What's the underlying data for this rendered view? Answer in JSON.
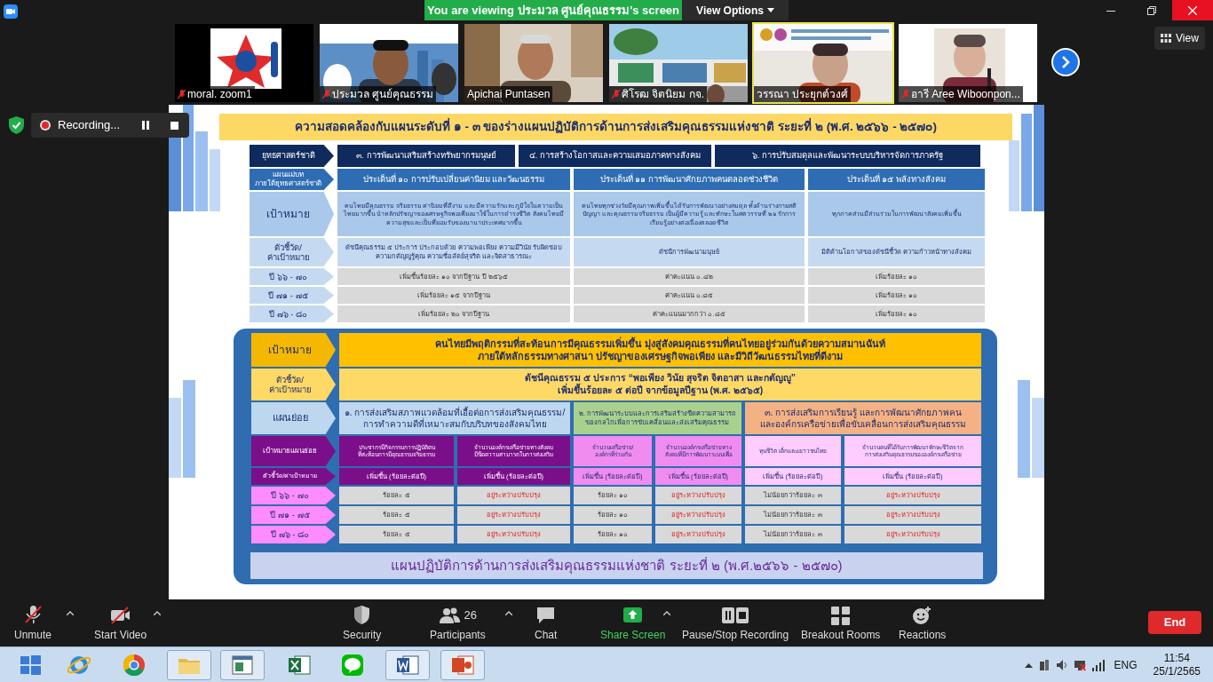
{
  "window": {
    "banner": "You are viewing ประมวล ศูนย์คุณธรรม's screen",
    "view_options": "View Options",
    "view_button": "View"
  },
  "participants": [
    {
      "name": "moral. zoom1",
      "muted": true,
      "selected": false
    },
    {
      "name": "ประมวล ศูนย์คุณธรรม",
      "muted": true,
      "selected": false
    },
    {
      "name": "Apichai Puntasen",
      "muted": false,
      "selected": false
    },
    {
      "name": "ศิโรฒ จิตนิยม  กจ.",
      "muted": true,
      "selected": false
    },
    {
      "name": "วรรณา ประยุกต์วงศ์",
      "muted": false,
      "selected": true
    },
    {
      "name": "อารี Aree Wiboonpon...",
      "muted": true,
      "selected": false
    }
  ],
  "recording": {
    "label": "Recording..."
  },
  "slide": {
    "title": "ความสอดคล้องกับแผนระดับที่ ๑ - ๓ ของร่างแผนปฏิบัติการด้านการส่งเสริมคุณธรรมแห่งชาติ ระยะที่ ๒ (พ.ศ. ๒๕๖๖ - ๒๕๗๐)",
    "alignment_table": [
      {
        "kind": "strategy",
        "label": "ยุทธศาสตร์ชาติ",
        "cells": [
          {
            "text": "๓. การพัฒนาเสริมสร้างทรัพยากรมนุษย์"
          },
          {
            "text": "๔. การสร้างโอกาสและความเสมอภาคทางสังคม"
          },
          {
            "text": "๖. การปรับสมดุลและพัฒนาระบบบริหารจัดการภาครัฐ"
          }
        ]
      },
      {
        "kind": "plan",
        "label": "แผนแม่บท\nภายใต้ยุทธศาสตร์ชาติ",
        "cells": [
          {
            "text": "ประเด็นที่ ๑๐ การปรับเปลี่ยนค่านิยม และวัฒนธรรม"
          },
          {
            "text": "ประเด็นที่ ๑๑ การพัฒนาศักยภาพคนตลอดช่วงชีวิต"
          },
          {
            "text": "ประเด็นที่ ๑๕ พลังทางสังคม"
          }
        ]
      },
      {
        "kind": "goal",
        "label": "เป้าหมาย",
        "cells": [
          {
            "text": "คนไทยมีคุณธรรม จริยธรรม ค่านิยมที่ดีงาม และมีความรักและภูมิใจในความเป็นไทยมากขึ้น นำหลักปรัชญาของเศรษฐกิจพอเพียงมาใช้ในการดำรงชีวิต สังคมไทยมีความสุขและเป็นที่ยอมรับของนานาประเทศมากขึ้น"
          },
          {
            "text": "คนไทยทุกช่วงวัยมีคุณภาพเพิ่มขึ้นได้รับการพัฒนาอย่างสมดุล ทั้งด้านร่างกายสติปัญญา และคุณธรรมจริยธรรม เป็นผู้มีความรู้ และทักษะในศตวรรษที่ ๒๑ รักการเรียนรู้อย่างต่อเนื่องตลอดชีวิต"
          },
          {
            "text": "ทุกภาคส่วนมีส่วนร่วมในการพัฒนาสังคมเพิ่มขึ้น"
          }
        ]
      },
      {
        "kind": "indicator",
        "label": "ตัวชี้วัด/\nค่าเป้าหมาย",
        "cells": [
          {
            "text": "ดัชนีคุณธรรม ๕ ประการ ประกอบด้วย ความพอเพียง ความมีวินัย รับผิดชอบ ความกตัญญูรู้คุณ ความซื่อสัตย์สุจริต และจิตสาธารณะ"
          },
          {
            "text": "ดัชนีการพัฒนามนุษย์"
          },
          {
            "text": "มิติด้านโอกาสของดัชนีชี้วัด ความก้าวหน้าทางสังคม"
          }
        ]
      },
      {
        "kind": "year",
        "label": "ปี ๖๖ - ๗๐",
        "cells": [
          {
            "text": "เพิ่มขึ้นร้อยละ ๑๐ จากปีฐาน ปี ๒๕๖๕"
          },
          {
            "text": "ค่าคะแนน ๐.๘๒"
          },
          {
            "text": "เพิ่มร้อยละ ๑๐"
          }
        ]
      },
      {
        "kind": "year",
        "label": "ปี ๗๑ - ๗๕",
        "cells": [
          {
            "text": "เพิ่มร้อยละ ๑๕ จากปีฐาน"
          },
          {
            "text": "ค่าคะแนน ๐.๘๕"
          },
          {
            "text": "เพิ่มร้อยละ ๑๐"
          }
        ]
      },
      {
        "kind": "year",
        "label": "ปี ๗๖ - ๘๐",
        "cells": [
          {
            "text": "เพิ่มร้อยละ ๒๐ จากปีฐาน"
          },
          {
            "text": "ค่าคะแนนมากกว่า ๐.๘๕"
          },
          {
            "text": "เพิ่มร้อยละ ๑๐"
          }
        ]
      }
    ],
    "plan_table": [
      {
        "kind": "goal",
        "label": "เป้าหมาย",
        "cells": [
          {
            "text": "คนไทยมีพฤติกรรมที่สะท้อนการมีคุณธรรมเพิ่มขึ้น มุ่งสู่สังคมคุณธรรมที่คนไทยอยู่ร่วมกันด้วยความสมานฉันท์\nภายใต้หลักธรรมทางศาสนา ปรัชญาของเศรษฐกิจพอเพียง และมีวิถีวัฒนธรรมไทยที่ดีงาม"
          }
        ]
      },
      {
        "kind": "indicator",
        "label": "ตัวชี้วัด/\nค่าเป้าหมาย",
        "cells": [
          {
            "text": "ดัชนีคุณธรรม ๕ ประการ “พอเพียง วินัย สุจริต จิตอาสา และกตัญญู”\nเพิ่มขึ้นร้อยละ ๕ ต่อปี จากข้อมูลปีฐาน (พ.ศ. ๒๕๖๕)"
          }
        ]
      },
      {
        "kind": "subplan",
        "label": "แผนย่อย",
        "cells": [
          {
            "text": "๑. การส่งเสริมสภาพแวดล้อมที่เอื้อต่อการส่งเสริมคุณธรรม/\nการทำความดีที่เหมาะสมกับบริบทของสังคมไทย"
          },
          {
            "text": "๒. การพัฒนาระบบและการเสริมสร้างขีดความสามารถ\nของกลไกเพื่อการขับเคลื่อนและส่งเสริมคุณธรรม"
          },
          {
            "text": "๓. การส่งเสริมการเรียนรู้ และการพัฒนาศักยภาพคน\nและองค์กรเครือข่ายเพื่อขับเคลื่อนการส่งเสริมคุณธรรม"
          }
        ]
      },
      {
        "kind": "subgoal",
        "label": "เป้าหมายแผนย่อย",
        "cells": [
          {
            "text": "ประชากรมีกิจกรรมการปฏิบัติตน\nที่สะท้อนการมีคุณธรรมจริยธรรม"
          },
          {
            "text": "จำนวนองค์กรเครือข่ายทางสังคม\nมีขีดความสามารถในการส่งเสริม"
          },
          {
            "text": "จำนวนเครือข่าย/\nองค์กรที่ร่วมกัน"
          },
          {
            "text": "จำนวนองค์กรเครือข่ายทาง\nสังคมที่มีการพัฒนาระบบเพื่อ"
          },
          {
            "text": "ทุนชีวิต เด็กและเยาวชนไทย"
          },
          {
            "text": "จำนวนคนที่ได้รับการพัฒนาทักษะชีวิตจาก\nการส่งเสริมคุณธรรมขององค์กรเครือข่าย"
          }
        ]
      },
      {
        "kind": "metric",
        "label": "ตัวชี้วัด/ค่าเป้าหมาย",
        "cells": [
          {
            "text": "เพิ่มขึ้น (ร้อยละต่อปี)"
          },
          {
            "text": "เพิ่มขึ้น (ร้อยละต่อปี)"
          },
          {
            "text": "เพิ่มขึ้น (ร้อยละต่อปี)"
          },
          {
            "text": "เพิ่มขึ้น (ร้อยละต่อปี)"
          },
          {
            "text": "เพิ่มขึ้น (ร้อยละต่อปี)"
          },
          {
            "text": "เพิ่มขึ้น (ร้อยละต่อปี)"
          }
        ]
      },
      {
        "kind": "year",
        "label": "ปี ๖๖ - ๗๐",
        "cells": [
          {
            "text": "ร้อยละ ๕",
            "pending": false
          },
          {
            "text": "อยู่ระหว่างปรับปรุง",
            "pending": true
          },
          {
            "text": "ร้อยละ ๑๐",
            "pending": false
          },
          {
            "text": "อยู่ระหว่างปรับปรุง",
            "pending": true
          },
          {
            "text": "ไม่น้อยกว่าร้อยละ ๓",
            "pending": false
          },
          {
            "text": "อยู่ระหว่างปรับปรุง",
            "pending": true
          }
        ]
      },
      {
        "kind": "year",
        "label": "ปี ๗๑ - ๗๕",
        "cells": [
          {
            "text": "ร้อยละ ๕",
            "pending": false
          },
          {
            "text": "อยู่ระหว่างปรับปรุง",
            "pending": true
          },
          {
            "text": "ร้อยละ ๑๐",
            "pending": false
          },
          {
            "text": "อยู่ระหว่างปรับปรุง",
            "pending": true
          },
          {
            "text": "ไม่น้อยกว่าร้อยละ ๓",
            "pending": false
          },
          {
            "text": "อยู่ระหว่างปรับปรุง",
            "pending": true
          }
        ]
      },
      {
        "kind": "year",
        "label": "ปี ๗๖ - ๘๐",
        "cells": [
          {
            "text": "ร้อยละ ๕",
            "pending": false
          },
          {
            "text": "อยู่ระหว่างปรับปรุง",
            "pending": true
          },
          {
            "text": "ร้อยละ ๑๐",
            "pending": false
          },
          {
            "text": "อยู่ระหว่างปรับปรุง",
            "pending": true
          },
          {
            "text": "ไม่น้อยกว่าร้อยละ ๓",
            "pending": false
          },
          {
            "text": "อยู่ระหว่างปรับปรุง",
            "pending": true
          }
        ]
      }
    ],
    "footer": "แผนปฏิบัติการด้านการส่งเสริมคุณธรรมแห่งชาติ ระยะที่ ๒ (พ.ศ.๒๕๖๖ - ๒๕๗๐)"
  },
  "toolbar": [
    {
      "kind": "mic",
      "label": "Unmute"
    },
    {
      "kind": "video",
      "label": "Start Video"
    },
    {
      "kind": "security",
      "label": "Security"
    },
    {
      "kind": "participants",
      "label": "Participants",
      "count": "26"
    },
    {
      "kind": "chat",
      "label": "Chat"
    },
    {
      "kind": "share",
      "label": "Share Screen"
    },
    {
      "kind": "recording",
      "label": "Pause/Stop Recording"
    },
    {
      "kind": "breakout",
      "label": "Breakout Rooms"
    },
    {
      "kind": "reactions",
      "label": "Reactions"
    }
  ],
  "end_button": "End",
  "taskbar": {
    "language": "ENG",
    "time": "11:54",
    "date": "25/1/2565"
  }
}
